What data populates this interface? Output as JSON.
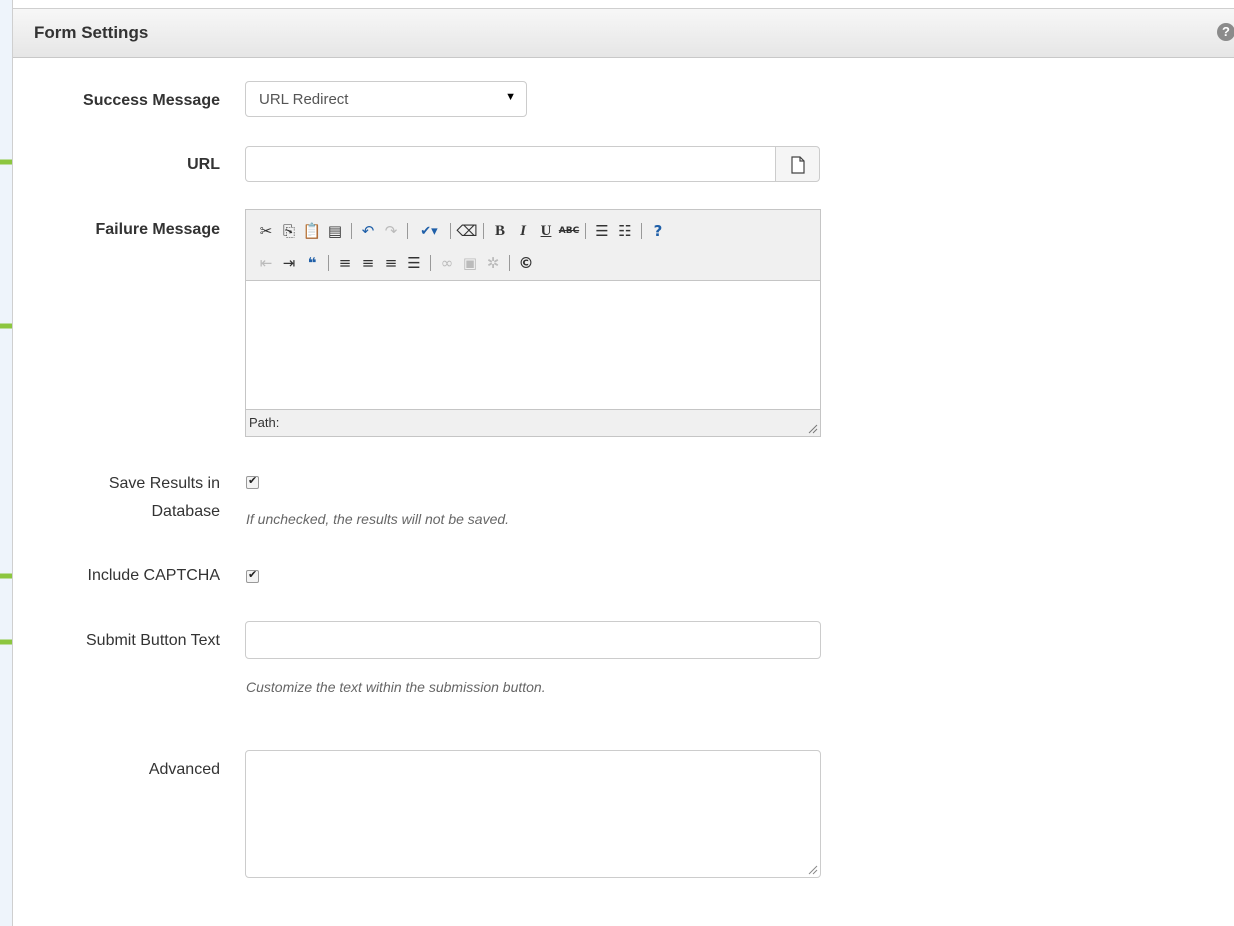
{
  "panel": {
    "title": "Form Settings",
    "help_icon": "question-circle-icon"
  },
  "success_message": {
    "label": "Success Message",
    "selected": "URL Redirect"
  },
  "url": {
    "label": "URL",
    "value": "",
    "browse_icon": "file-icon"
  },
  "failure_message": {
    "label": "Failure Message",
    "status_text": "Path:",
    "toolbar_row1": [
      "cut-icon",
      "copy-icon",
      "paste-icon",
      "paste-text-icon",
      "undo-icon",
      "redo-icon",
      "spellcheck-icon",
      "eraser-icon",
      "bold-icon",
      "italic-icon",
      "underline-icon",
      "strikethrough-icon",
      "bullet-list-icon",
      "numbered-list-icon",
      "help-icon"
    ],
    "toolbar_row2": [
      "outdent-icon",
      "indent-icon",
      "blockquote-icon",
      "align-left-icon",
      "align-center-icon",
      "align-right-icon",
      "justify-icon",
      "link-icon",
      "image-icon",
      "unlink-icon",
      "copyright-icon"
    ]
  },
  "save_results": {
    "label_line1": "Save Results in",
    "label_line2": "Database",
    "checked": true,
    "help": "If unchecked, the results will not be saved."
  },
  "captcha": {
    "label": "Include CAPTCHA",
    "checked": true
  },
  "submit_text": {
    "label": "Submit Button Text",
    "value": "",
    "help": "Customize the text within the submission button."
  },
  "advanced": {
    "label": "Advanced",
    "value": ""
  },
  "colors": {
    "arrow": "#8cc63f",
    "background": "#eef4fb",
    "header_bg": "#e9e9e9"
  }
}
